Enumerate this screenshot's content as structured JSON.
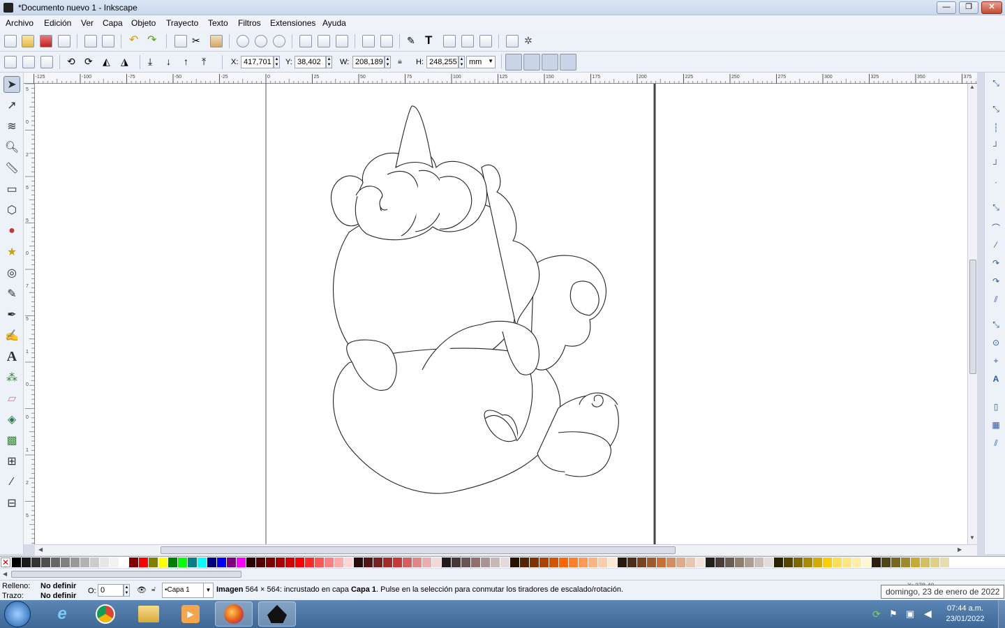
{
  "window": {
    "title": "*Documento nuevo 1 - Inkscape",
    "minimize_label": "—",
    "maximize_label": "❐",
    "close_label": "✕"
  },
  "menu": [
    "Archivo",
    "Edición",
    "Ver",
    "Capa",
    "Objeto",
    "Trayecto",
    "Texto",
    "Filtros",
    "Extensiones",
    "Ayuda"
  ],
  "tool_controls": {
    "x_label": "X:",
    "x_value": "417,701",
    "y_label": "Y:",
    "y_value": "38,402",
    "w_label": "W:",
    "w_value": "208,189",
    "h_label": "H:",
    "h_value": "248,255",
    "unit": "mm"
  },
  "ruler": {
    "h_ticks": [
      "-125",
      "-100",
      "-75",
      "-50",
      "-25",
      "0",
      "25",
      "50",
      "75",
      "100",
      "125",
      "150",
      "175",
      "200",
      "225",
      "250",
      "275",
      "300",
      "325",
      "350",
      "375"
    ],
    "v_ticks": [
      "5",
      "0",
      "2",
      "5",
      "5",
      "0",
      "7",
      "5",
      "1",
      "0",
      "0",
      "1",
      "2",
      "5"
    ]
  },
  "statusbar": {
    "fill_label": "Relleno:",
    "fill_value": "No definir",
    "stroke_label": "Trazo:",
    "stroke_value": "No definir",
    "opacity_label": "O:",
    "opacity_value": "0",
    "layer": "•Capa 1",
    "message_bold": "Imagen",
    "message_1": " 564 × 564: incrustado en capa ",
    "message_layer": "Capa 1",
    "message_2": ". Pulse en la selección para conmutar los tiradores de escalado/rotación.",
    "coords_label": "X: 278,40"
  },
  "tooltip": "domingo, 23 de enero de 2022",
  "clock": {
    "time": "07:44 a.m.",
    "date": "23/01/2022"
  },
  "colors": {
    "accent": "#3d6795",
    "palette": [
      "#000000",
      "#1a1a1a",
      "#333333",
      "#4d4d4d",
      "#666666",
      "#808080",
      "#999999",
      "#b3b3b3",
      "#cccccc",
      "#e6e6e6",
      "#f2f2f2",
      "#ffffff",
      "#800000",
      "#ff0000",
      "#808000",
      "#ffff00",
      "#008000",
      "#00ff00",
      "#008080",
      "#00ffff",
      "#000080",
      "#0000ff",
      "#800080",
      "#ff00ff",
      "#2b0000",
      "#550000",
      "#800000",
      "#aa0000",
      "#d40000",
      "#ff0000",
      "#ff2a2a",
      "#ff5555",
      "#ff8080",
      "#ffaaaa",
      "#ffd5d5",
      "#280b0b",
      "#501616",
      "#782121",
      "#a02c2c",
      "#c83737",
      "#d35f5f",
      "#de8787",
      "#e9afaf",
      "#f4d7d7",
      "#241c1c",
      "#483737",
      "#6c5353",
      "#916f6f",
      "#ac9393",
      "#c8b7b7",
      "#e3dbdb",
      "#2b1100",
      "#552200",
      "#803300",
      "#aa4400",
      "#d45500",
      "#ff6600",
      "#ff7f2a",
      "#ff9955",
      "#ffb380",
      "#ffccaa",
      "#ffe6d5",
      "#28170b",
      "#502d16",
      "#784421",
      "#a05a2c",
      "#c87137",
      "#d38d5f",
      "#deaa87",
      "#e9c6af",
      "#f4e3d7",
      "#241f1c",
      "#483e37",
      "#6c5d53",
      "#917c6f",
      "#ac9d93",
      "#c8beb7",
      "#e3dedb",
      "#2b2200",
      "#554400",
      "#806600",
      "#aa8800",
      "#d4aa00",
      "#ffcc00",
      "#ffdd55",
      "#ffe680",
      "#ffeeaa",
      "#fff6d5",
      "#28220b",
      "#504416",
      "#786721",
      "#a0892c",
      "#c8ab37",
      "#d4be5f",
      "#dfcf87",
      "#e9ddaf"
    ]
  }
}
